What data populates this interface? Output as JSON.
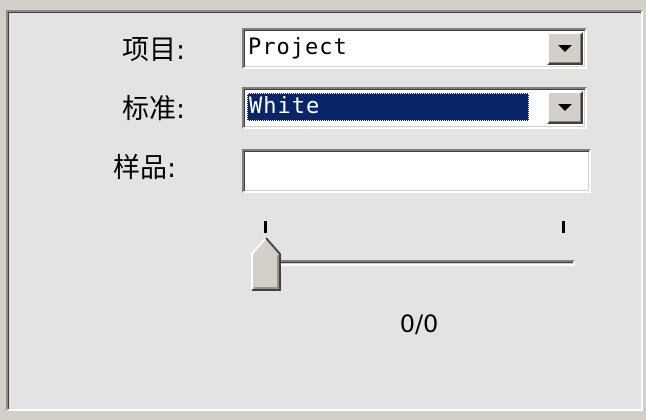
{
  "form": {
    "project_label": "项目:",
    "standard_label": "标准:",
    "sample_label": "样品:",
    "project_value": "Project",
    "standard_value": "White",
    "sample_value": ""
  },
  "slider": {
    "readout": "0/0",
    "position_fraction": 0
  },
  "colors": {
    "panel_bg": "#e3e3e3",
    "selection_bg": "#0a246a",
    "selection_text": "#ffffff",
    "button_face": "#d4d0c8"
  },
  "icons": {
    "dropdown_arrow": "chevron-down-icon"
  }
}
